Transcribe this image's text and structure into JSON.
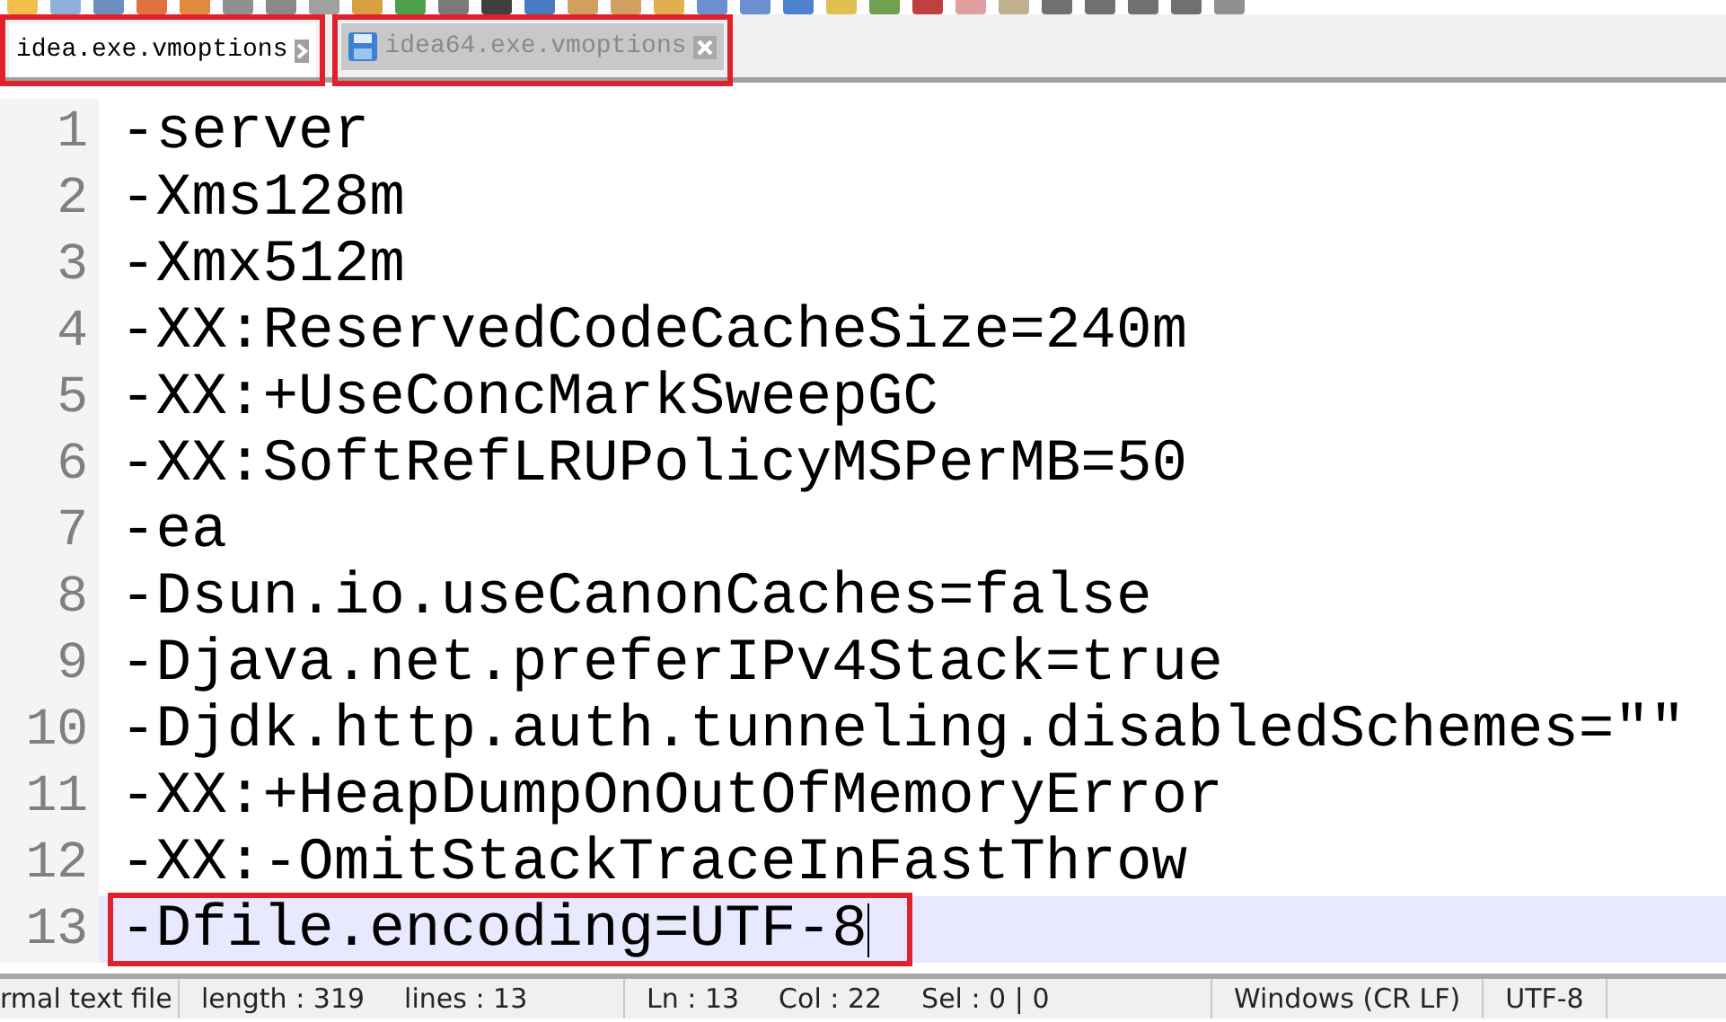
{
  "tabs": [
    {
      "label": "idea.exe.vmoptions",
      "selected": true,
      "marked": true
    },
    {
      "label": "idea64.exe.vmoptions",
      "selected": false,
      "marked": true
    }
  ],
  "lines": [
    {
      "number": "1",
      "text": "-server",
      "current": false,
      "marked": false
    },
    {
      "number": "2",
      "text": "-Xms128m",
      "current": false,
      "marked": false
    },
    {
      "number": "3",
      "text": "-Xmx512m",
      "current": false,
      "marked": false
    },
    {
      "number": "4",
      "text": "-XX:ReservedCodeCacheSize=240m",
      "current": false,
      "marked": false
    },
    {
      "number": "5",
      "text": "-XX:+UseConcMarkSweepGC",
      "current": false,
      "marked": false
    },
    {
      "number": "6",
      "text": "-XX:SoftRefLRUPolicyMSPerMB=50",
      "current": false,
      "marked": false
    },
    {
      "number": "7",
      "text": "-ea",
      "current": false,
      "marked": false
    },
    {
      "number": "8",
      "text": "-Dsun.io.useCanonCaches=false",
      "current": false,
      "marked": false
    },
    {
      "number": "9",
      "text": "-Djava.net.preferIPv4Stack=true",
      "current": false,
      "marked": false
    },
    {
      "number": "10",
      "text": "-Djdk.http.auth.tunneling.disabledSchemes=\"\"",
      "current": false,
      "marked": false
    },
    {
      "number": "11",
      "text": "-XX:+HeapDumpOnOutOfMemoryError",
      "current": false,
      "marked": false
    },
    {
      "number": "12",
      "text": "-XX:-OmitStackTraceInFastThrow",
      "current": false,
      "marked": false
    },
    {
      "number": "13",
      "text": "-Dfile.encoding=UTF-8",
      "current": true,
      "marked": true
    }
  ],
  "status_bar": [
    {
      "texts": [
        "rmal text file"
      ]
    },
    {
      "texts": [
        "length : 319",
        "lines : 13"
      ]
    },
    {
      "texts": [
        "Ln : 13",
        "Col : 22",
        "Sel : 0 | 0"
      ]
    },
    {
      "texts": [
        "Windows (CR LF)"
      ]
    },
    {
      "texts": [
        "UTF-8"
      ]
    }
  ]
}
